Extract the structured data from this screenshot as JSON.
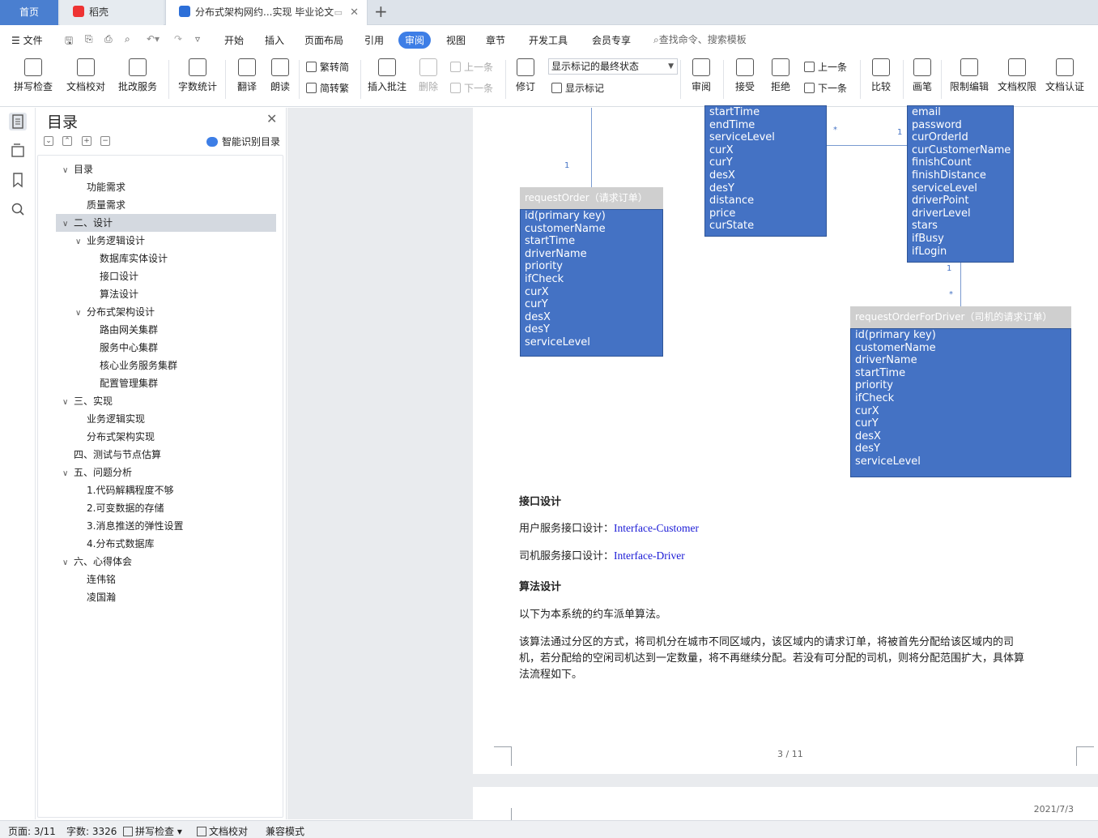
{
  "tabs": {
    "home": "首页",
    "daoke": "稻壳",
    "doc": "分布式架构网约...实现 毕业论文",
    "add": "+"
  },
  "menu": {
    "file": "文件",
    "items": [
      "开始",
      "插入",
      "页面布局",
      "引用",
      "审阅",
      "视图",
      "章节",
      "开发工具",
      "会员专享"
    ],
    "active": "审阅",
    "search": "查找命令、搜索模板"
  },
  "ribbon": {
    "spell_check": "拼写检查",
    "doc_proof": "文档校对",
    "correct_service": "批改服务",
    "word_count": "字数统计",
    "translate": "翻译",
    "read_aloud": "朗读",
    "trad_to_simp": "繁转简",
    "simp_to_trad": "简转繁",
    "insert_comment": "插入批注",
    "delete": "删除",
    "prev": "上一条",
    "next": "下一条",
    "revise": "修订",
    "markup_state": "显示标记的最终状态",
    "show_markup": "显示标记",
    "review": "审阅",
    "accept": "接受",
    "reject": "拒绝",
    "prev2": "上一条",
    "next2": "下一条",
    "compare": "比较",
    "pen": "画笔",
    "restrict_edit": "限制编辑",
    "doc_rights": "文档权限",
    "doc_cert": "文档认证"
  },
  "toc": {
    "title": "目录",
    "smart": "智能识别目录",
    "items": [
      {
        "label": "目录",
        "level": 0,
        "chev": true,
        "sel": false
      },
      {
        "label": "功能需求",
        "level": 1,
        "chev": false,
        "sel": false
      },
      {
        "label": "质量需求",
        "level": 1,
        "chev": false,
        "sel": false
      },
      {
        "label": "二、设计",
        "level": 0,
        "chev": true,
        "sel": true
      },
      {
        "label": "业务逻辑设计",
        "level": 1,
        "chev": true,
        "sel": false
      },
      {
        "label": "数据库实体设计",
        "level": 2,
        "chev": false,
        "sel": false
      },
      {
        "label": "接口设计",
        "level": 2,
        "chev": false,
        "sel": false
      },
      {
        "label": "算法设计",
        "level": 2,
        "chev": false,
        "sel": false
      },
      {
        "label": "分布式架构设计",
        "level": 1,
        "chev": true,
        "sel": false
      },
      {
        "label": "路由网关集群",
        "level": 2,
        "chev": false,
        "sel": false
      },
      {
        "label": "服务中心集群",
        "level": 2,
        "chev": false,
        "sel": false
      },
      {
        "label": "核心业务服务集群",
        "level": 2,
        "chev": false,
        "sel": false
      },
      {
        "label": "配置管理集群",
        "level": 2,
        "chev": false,
        "sel": false
      },
      {
        "label": "三、实现",
        "level": 0,
        "chev": true,
        "sel": false
      },
      {
        "label": "业务逻辑实现",
        "level": 1,
        "chev": false,
        "sel": false
      },
      {
        "label": "分布式架构实现",
        "level": 1,
        "chev": false,
        "sel": false
      },
      {
        "label": "四、测试与节点估算",
        "level": 0,
        "chev": false,
        "sel": false
      },
      {
        "label": "五、问题分析",
        "level": 0,
        "chev": true,
        "sel": false
      },
      {
        "label": "1.代码解耦程度不够",
        "level": 1,
        "chev": false,
        "sel": false
      },
      {
        "label": "2.可变数据的存储",
        "level": 1,
        "chev": false,
        "sel": false
      },
      {
        "label": "3.消息推送的弹性设置",
        "level": 1,
        "chev": false,
        "sel": false
      },
      {
        "label": "4.分布式数据库",
        "level": 1,
        "chev": false,
        "sel": false
      },
      {
        "label": "六、心得体会",
        "level": 0,
        "chev": true,
        "sel": false
      },
      {
        "label": "连伟铭",
        "level": 1,
        "chev": false,
        "sel": false
      },
      {
        "label": "凌国瀚",
        "level": 1,
        "chev": false,
        "sel": false
      }
    ]
  },
  "diagram": {
    "order_fields": [
      "startTime",
      "endTime",
      "serviceLevel",
      "curX",
      "curY",
      "desX",
      "desY",
      "distance",
      "price",
      "curState"
    ],
    "driver_fields": [
      "email",
      "password",
      "curOrderId",
      "curCustomerName",
      "finishCount",
      "finishDistance",
      "serviceLevel",
      "driverPoint",
      "driverLevel",
      "stars",
      "ifBusy",
      "ifLogin"
    ],
    "request_order": {
      "title": "requestOrder（请求订单）",
      "fields": [
        "id(primary key)",
        "customerName",
        "startTime",
        "driverName",
        "priority",
        "ifCheck",
        "curX",
        "curY",
        "desX",
        "desY",
        "serviceLevel"
      ]
    },
    "request_order_driver": {
      "title": "requestOrderForDriver（司机的请求订单）",
      "fields": [
        "id(primary key)",
        "customerName",
        "driverName",
        "startTime",
        "priority",
        "ifCheck",
        "curX",
        "curY",
        "desX",
        "desY",
        "serviceLevel"
      ]
    },
    "cardinalities": {
      "a": "1",
      "b": "*",
      "c": "1",
      "d": "1",
      "e": "*"
    }
  },
  "doc": {
    "h_interface": "接口设计",
    "user_iface_label": "用户服务接口设计：",
    "user_iface_link": "Interface-Customer",
    "driver_iface_label": "司机服务接口设计：",
    "driver_iface_link": "Interface-Driver",
    "h_algo": "算法设计",
    "algo_intro": "以下为本系统的约车派单算法。",
    "algo_l1": "该算法通过分区的方式，将司机分在城市不同区域内，该区域内的请求订单，将被首先分配给该区域内的司",
    "algo_l2": "机，若分配给的空闲司机达到一定数量，将不再继续分配。若没有可分配的司机，则将分配范围扩大，具体算",
    "algo_l3": "法流程如下。",
    "page_number": "3 / 11",
    "next_page_date": "2021/7/3"
  },
  "status": {
    "page": "页面: 3/11",
    "words": "字数: 3326",
    "spell": "拼写检查",
    "proof": "文档校对",
    "compat": "兼容模式"
  }
}
